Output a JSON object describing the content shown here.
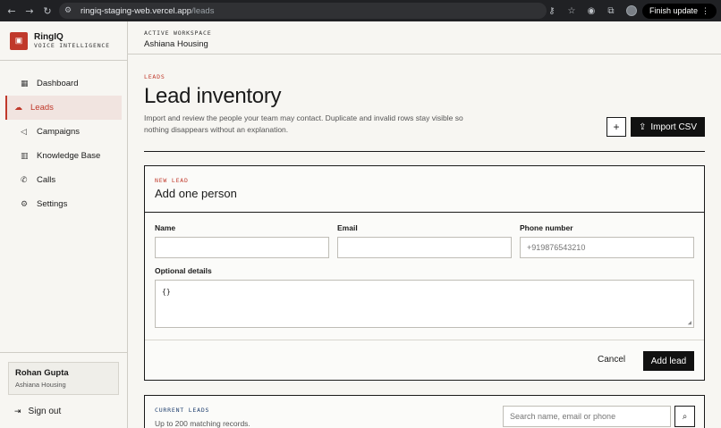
{
  "browser": {
    "url_host": "ringiq-staging-web.vercel.app",
    "url_path": "/leads",
    "finish_update_label": "Finish update"
  },
  "sidebar": {
    "brand_name": "RingIQ",
    "brand_sub": "VOICE INTELLIGENCE",
    "items": [
      {
        "label": "Dashboard",
        "icon": "grid-icon"
      },
      {
        "label": "Leads",
        "icon": "cloud-upload-icon",
        "active": true
      },
      {
        "label": "Campaigns",
        "icon": "megaphone-icon"
      },
      {
        "label": "Knowledge Base",
        "icon": "book-icon"
      },
      {
        "label": "Calls",
        "icon": "phone-icon"
      },
      {
        "label": "Settings",
        "icon": "gear-icon"
      }
    ],
    "user_name": "Rohan Gupta",
    "user_org": "Ashiana Housing",
    "signout_label": "Sign out"
  },
  "topbar": {
    "workspace_label": "ACTIVE WORKSPACE",
    "workspace_name": "Ashiana Housing"
  },
  "page": {
    "kicker": "LEADS",
    "title": "Lead inventory",
    "description": "Import and review the people your team may contact. Duplicate and invalid rows stay visible so nothing disappears without an explanation.",
    "plus_label": "+",
    "import_label": "Import CSV"
  },
  "new_lead": {
    "kicker": "NEW LEAD",
    "title": "Add one person",
    "name_label": "Name",
    "name_value": "",
    "email_label": "Email",
    "email_value": "",
    "phone_label": "Phone number",
    "phone_placeholder": "+919876543210",
    "details_label": "Optional details",
    "details_value": "{}",
    "cancel_label": "Cancel",
    "add_label": "Add lead"
  },
  "current_leads": {
    "kicker": "CURRENT LEADS",
    "subtitle": "Up to 200 matching records.",
    "search_placeholder": "Search name, email or phone"
  },
  "colors": {
    "accent": "#c0392b",
    "dark": "#111111",
    "background": "#f7f6f2"
  }
}
